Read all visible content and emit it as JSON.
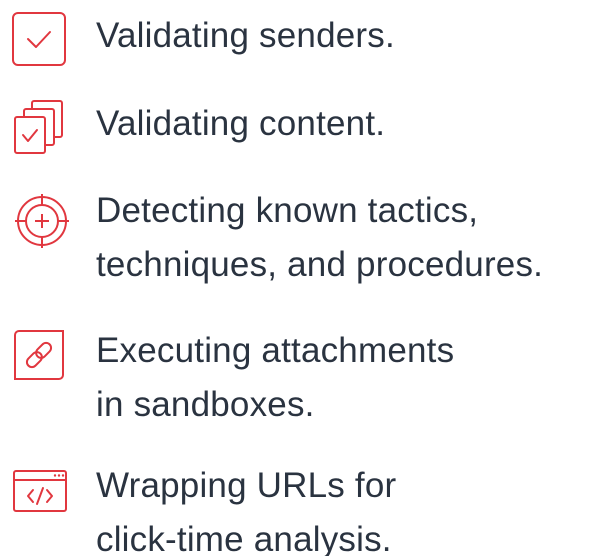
{
  "accent_color": "#e1373f",
  "text_color": "#2a3340",
  "items": [
    {
      "icon": "checkbox-icon",
      "lines": [
        "Validating senders."
      ]
    },
    {
      "icon": "stacked-documents-check-icon",
      "lines": [
        "Validating content."
      ]
    },
    {
      "icon": "crosshair-target-icon",
      "lines": [
        "Detecting known tactics,",
        "techniques, and procedures."
      ]
    },
    {
      "icon": "link-chain-icon",
      "lines": [
        "Executing attachments",
        "in sandboxes."
      ]
    },
    {
      "icon": "browser-code-icon",
      "lines": [
        "Wrapping URLs for",
        "click-time analysis."
      ]
    }
  ]
}
